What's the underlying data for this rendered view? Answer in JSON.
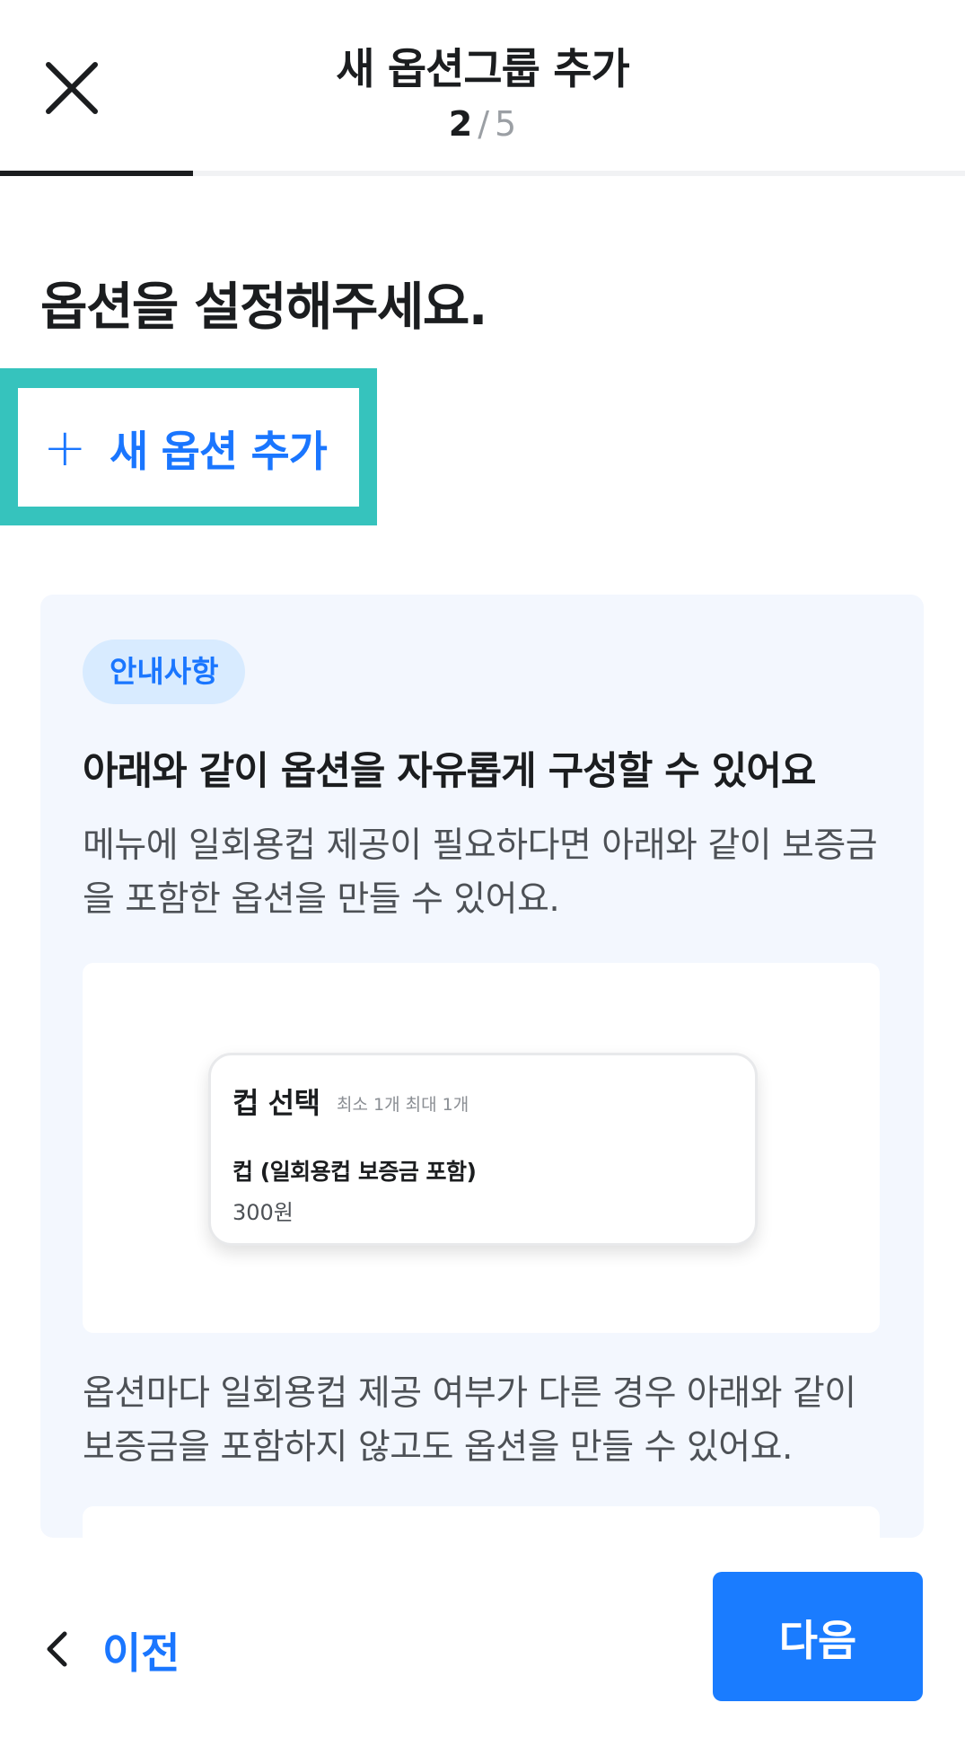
{
  "header": {
    "title": "새 옵션그룹 추가",
    "step_current": "2",
    "step_separator": "/",
    "step_total": "5",
    "progress_fraction": 0.2
  },
  "main": {
    "heading": "옵션을 설정해주세요.",
    "add_option_label": "새 옵션 추가"
  },
  "info": {
    "badge": "안내사항",
    "title": "아래와 같이 옵션을 자유롭게 구성할 수 있어요",
    "desc1": "메뉴에 일회용컵 제공이 필요하다면 아래와 같이 보증금을 포함한 옵션을 만들 수 있어요.",
    "example": {
      "title": "컵 선택",
      "subtitle": "최소 1개 최대 1개",
      "item_name": "컵 (일회용컵 보증금 포함)",
      "item_price": "300원"
    },
    "desc2": "옵션마다 일회용컵 제공 여부가 다른 경우 아래와 같이 보증금을 포함하지 않고도 옵션을 만들 수 있어요."
  },
  "footer": {
    "prev_label": "이전",
    "next_label": "다음"
  },
  "colors": {
    "accent": "#1a76ff",
    "highlight": "#36c3bd",
    "info_bg": "#f3f7fe",
    "badge_bg": "#d8ebff"
  },
  "icons": {
    "close": "close-icon",
    "plus": "plus-icon",
    "back": "chevron-left-icon"
  }
}
